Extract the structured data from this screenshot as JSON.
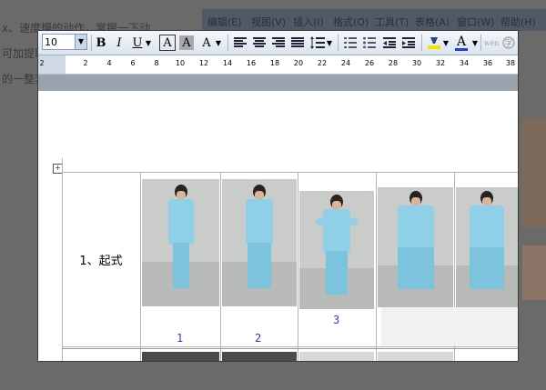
{
  "background": {
    "text_lines": [
      "x、速度慢的动作，掌握一下动",
      "可加提取。",
      "的一整套"
    ],
    "menu_items": [
      "编辑(E)",
      "视图(V)",
      "插入(I)",
      "格式(O)",
      "工具(T)",
      "表格(A)",
      "窗口(W)",
      "帮助(H)"
    ]
  },
  "toolbar": {
    "font_size": "10",
    "bold": "B",
    "italic": "I",
    "underline": "U",
    "char_border": "A",
    "char_shading": "A",
    "text_effect": "A",
    "font_color": "A",
    "pinyin": "wén"
  },
  "ruler": {
    "start": "2",
    "ticks": [
      "2",
      "4",
      "6",
      "8",
      "10",
      "12",
      "14",
      "16",
      "18",
      "20",
      "22",
      "24",
      "26",
      "28",
      "30",
      "32",
      "34",
      "36",
      "38"
    ]
  },
  "table": {
    "row_label": "1、起式",
    "figure_numbers": [
      "1",
      "2",
      "3"
    ]
  },
  "colors": {
    "toolbar_top": "#f4f7fb",
    "toolbar_bottom": "#dbe4ee",
    "figure_number": "#2b3bd0",
    "costume": "#8fd0e8"
  }
}
